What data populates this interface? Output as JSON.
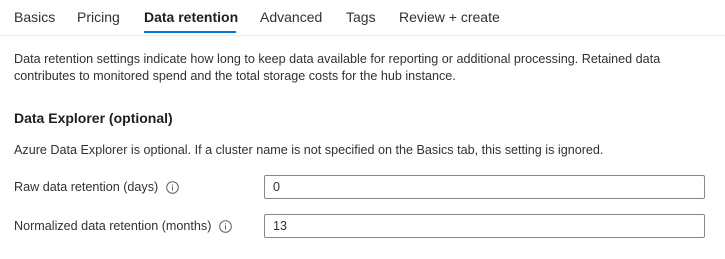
{
  "tabs": [
    {
      "label": "Basics"
    },
    {
      "label": "Pricing"
    },
    {
      "label": "Data retention"
    },
    {
      "label": "Advanced"
    },
    {
      "label": "Tags"
    },
    {
      "label": "Review + create"
    }
  ],
  "active_tab": "Data retention",
  "description": "Data retention settings indicate how long to keep data available for reporting or additional processing. Retained data contributes to monitored spend and the total storage costs for the hub instance.",
  "section": {
    "title": "Data Explorer (optional)",
    "description": "Azure Data Explorer is optional. If a cluster name is not specified on the Basics tab, this setting is ignored."
  },
  "fields": {
    "raw": {
      "label": "Raw data retention (days)",
      "value": "0",
      "icon": "info-icon"
    },
    "normalized": {
      "label": "Normalized data retention (months)",
      "value": "13",
      "icon": "info-icon"
    }
  },
  "colors": {
    "accent": "#0078d4",
    "text": "#323130",
    "border": "#8a8886"
  }
}
